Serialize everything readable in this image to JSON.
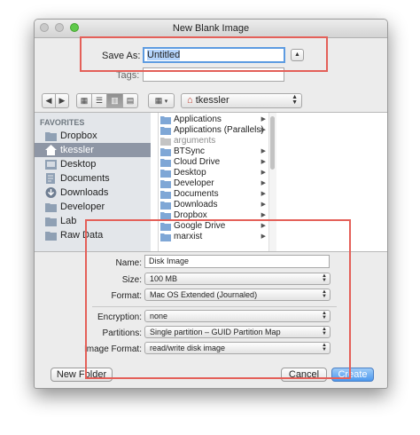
{
  "window": {
    "title": "New Blank Image"
  },
  "save": {
    "label": "Save As:",
    "value": "Untitled",
    "tags_label": "Tags:"
  },
  "toolbar": {
    "back": "◀",
    "forward": "▶",
    "view_icon": "▦",
    "list_icon": "☰",
    "column_icon": "▥",
    "coverflow_icon": "▤",
    "arrange_icon": "▦",
    "location": "tkessler"
  },
  "sidebar": {
    "heading": "FAVORITES",
    "items": [
      {
        "label": "Dropbox",
        "icon": "folder-icon"
      },
      {
        "label": "tkessler",
        "icon": "home-icon"
      },
      {
        "label": "Desktop",
        "icon": "desktop-icon"
      },
      {
        "label": "Documents",
        "icon": "documents-icon"
      },
      {
        "label": "Downloads",
        "icon": "downloads-icon"
      },
      {
        "label": "Developer",
        "icon": "folder-icon"
      },
      {
        "label": "Lab",
        "icon": "folder-icon"
      },
      {
        "label": "Raw Data",
        "icon": "folder-icon"
      }
    ]
  },
  "files": [
    {
      "label": "Applications",
      "arrow": "▶",
      "gray": false
    },
    {
      "label": "Applications (Parallels)",
      "arrow": "▶",
      "gray": false
    },
    {
      "label": "arguments",
      "arrow": "",
      "gray": true
    },
    {
      "label": "BTSync",
      "arrow": "▶",
      "gray": false
    },
    {
      "label": "Cloud Drive",
      "arrow": "▶",
      "gray": false
    },
    {
      "label": "Desktop",
      "arrow": "▶",
      "gray": false
    },
    {
      "label": "Developer",
      "arrow": "▶",
      "gray": false
    },
    {
      "label": "Documents",
      "arrow": "▶",
      "gray": false
    },
    {
      "label": "Downloads",
      "arrow": "▶",
      "gray": false
    },
    {
      "label": "Dropbox",
      "arrow": "▶",
      "gray": false
    },
    {
      "label": "Google Drive",
      "arrow": "▶",
      "gray": false
    },
    {
      "label": "marxist",
      "arrow": "▶",
      "gray": false
    }
  ],
  "options": {
    "name_label": "Name:",
    "name_value": "Disk Image",
    "size_label": "Size:",
    "size_value": "100 MB",
    "format_label": "Format:",
    "format_value": "Mac OS Extended (Journaled)",
    "encryption_label": "Encryption:",
    "encryption_value": "none",
    "partitions_label": "Partitions:",
    "partitions_value": "Single partition – GUID Partition Map",
    "image_format_label": "Image Format:",
    "image_format_value": "read/write disk image"
  },
  "buttons": {
    "new_folder": "New Folder",
    "cancel": "Cancel",
    "create": "Create"
  },
  "colors": {
    "highlight": "#e46059",
    "selection": "#8e96a5",
    "default_button": "#4c98ee",
    "folder": "#7fa7d6"
  }
}
